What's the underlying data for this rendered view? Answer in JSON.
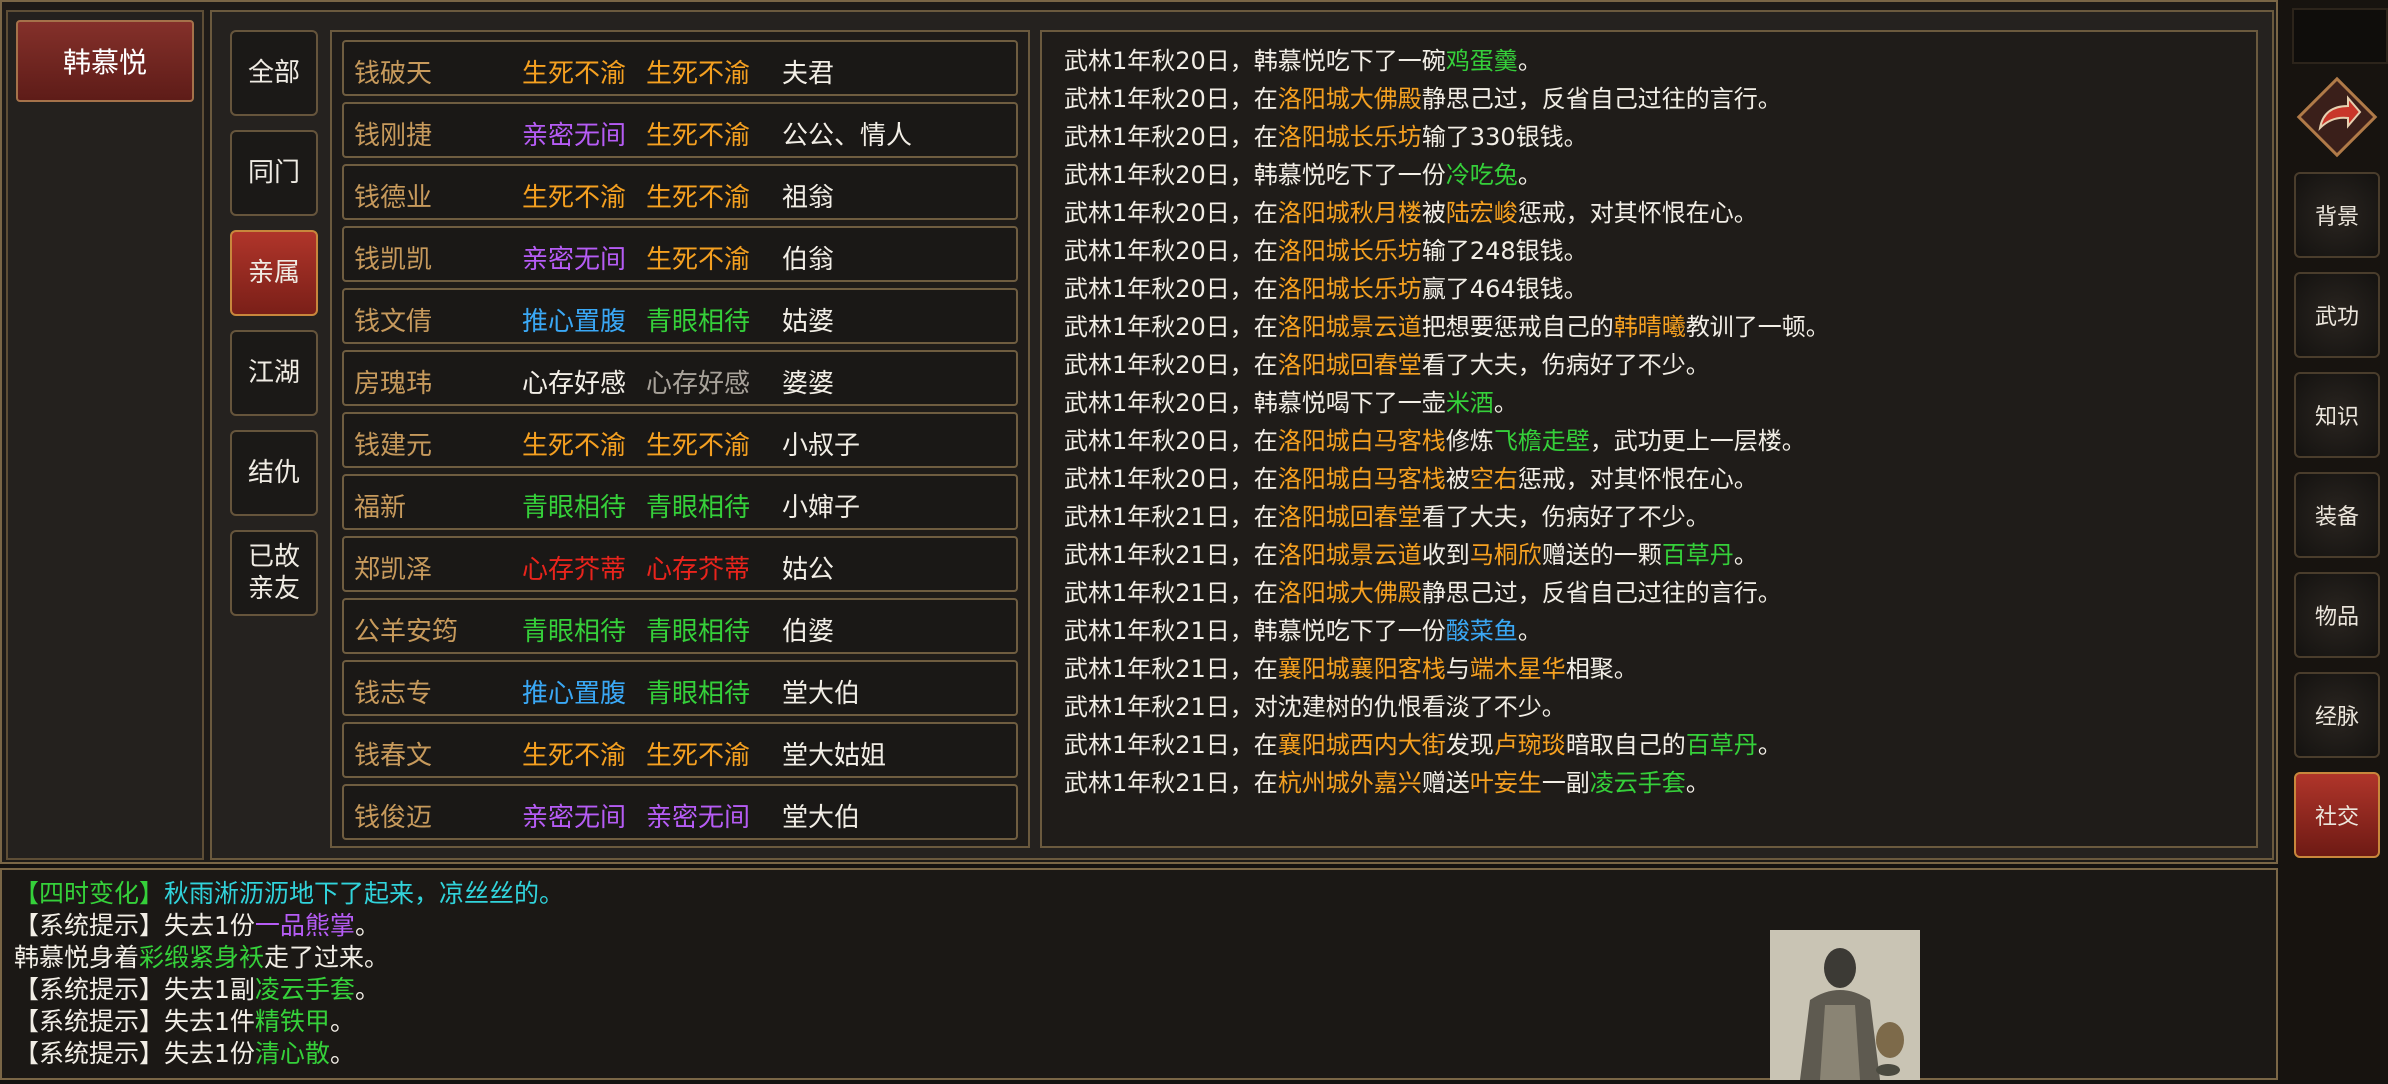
{
  "character": {
    "name": "韩慕悦"
  },
  "colors": {
    "orange": "#f5a020",
    "purple": "#b65cf5",
    "blue": "#3aa8f5",
    "green": "#35d03a",
    "red": "#e8241c",
    "white": "#f2eee6",
    "gray": "#a8a29a",
    "brown": "#c79a5c",
    "cyan": "#31d4dc"
  },
  "tabs": [
    {
      "label": "全部"
    },
    {
      "label": "同门"
    },
    {
      "label": "亲属",
      "active": true
    },
    {
      "label": "江湖"
    },
    {
      "label": "结仇"
    },
    {
      "label": "已故\n亲友"
    }
  ],
  "relations": [
    {
      "name": "钱破天",
      "rel1": "生死不渝",
      "c1": "orange",
      "rel2": "生死不渝",
      "c2": "orange",
      "relation": "夫君"
    },
    {
      "name": "钱刚捷",
      "rel1": "亲密无间",
      "c1": "purple",
      "rel2": "生死不渝",
      "c2": "orange",
      "relation": "公公、情人"
    },
    {
      "name": "钱德业",
      "rel1": "生死不渝",
      "c1": "orange",
      "rel2": "生死不渝",
      "c2": "orange",
      "relation": "祖翁"
    },
    {
      "name": "钱凯凯",
      "rel1": "亲密无间",
      "c1": "purple",
      "rel2": "生死不渝",
      "c2": "orange",
      "relation": "伯翁"
    },
    {
      "name": "钱文倩",
      "rel1": "推心置腹",
      "c1": "blue",
      "rel2": "青眼相待",
      "c2": "green",
      "relation": "姑婆"
    },
    {
      "name": "房瑰玮",
      "rel1": "心存好感",
      "c1": "white",
      "rel2": "心存好感",
      "c2": "gray",
      "relation": "婆婆"
    },
    {
      "name": "钱建元",
      "rel1": "生死不渝",
      "c1": "orange",
      "rel2": "生死不渝",
      "c2": "orange",
      "relation": "小叔子"
    },
    {
      "name": "福新",
      "rel1": "青眼相待",
      "c1": "green",
      "rel2": "青眼相待",
      "c2": "green",
      "relation": "小婶子"
    },
    {
      "name": "郑凯泽",
      "rel1": "心存芥蒂",
      "c1": "red",
      "rel2": "心存芥蒂",
      "c2": "red",
      "relation": "姑公"
    },
    {
      "name": "公羊安筠",
      "rel1": "青眼相待",
      "c1": "green",
      "rel2": "青眼相待",
      "c2": "green",
      "relation": "伯婆"
    },
    {
      "name": "钱志专",
      "rel1": "推心置腹",
      "c1": "blue",
      "rel2": "青眼相待",
      "c2": "green",
      "relation": "堂大伯"
    },
    {
      "name": "钱春文",
      "rel1": "生死不渝",
      "c1": "orange",
      "rel2": "生死不渝",
      "c2": "orange",
      "relation": "堂大姑姐"
    },
    {
      "name": "钱俊迈",
      "rel1": "亲密无间",
      "c1": "purple",
      "rel2": "亲密无间",
      "c2": "purple",
      "relation": "堂大伯"
    }
  ],
  "log": [
    [
      [
        "武林1年秋20日，韩慕悦吃下了一碗",
        "white"
      ],
      [
        "鸡蛋羹",
        "green"
      ],
      [
        "。",
        "white"
      ]
    ],
    [
      [
        "武林1年秋20日，在",
        "white"
      ],
      [
        "洛阳城大佛殿",
        "orange"
      ],
      [
        "静思己过，反省自己过往的言行。",
        "white"
      ]
    ],
    [
      [
        "武林1年秋20日，在",
        "white"
      ],
      [
        "洛阳城长乐坊",
        "orange"
      ],
      [
        "输了330银钱。",
        "white"
      ]
    ],
    [
      [
        "武林1年秋20日，韩慕悦吃下了一份",
        "white"
      ],
      [
        "冷吃兔",
        "green"
      ],
      [
        "。",
        "white"
      ]
    ],
    [
      [
        "武林1年秋20日，在",
        "white"
      ],
      [
        "洛阳城秋月楼",
        "orange"
      ],
      [
        "被",
        "white"
      ],
      [
        "陆宏峻",
        "orange"
      ],
      [
        "惩戒，对其怀恨在心。",
        "white"
      ]
    ],
    [
      [
        "武林1年秋20日，在",
        "white"
      ],
      [
        "洛阳城长乐坊",
        "orange"
      ],
      [
        "输了248银钱。",
        "white"
      ]
    ],
    [
      [
        "武林1年秋20日，在",
        "white"
      ],
      [
        "洛阳城长乐坊",
        "orange"
      ],
      [
        "赢了464银钱。",
        "white"
      ]
    ],
    [
      [
        "武林1年秋20日，在",
        "white"
      ],
      [
        "洛阳城景云道",
        "orange"
      ],
      [
        "把想要惩戒自己的",
        "white"
      ],
      [
        "韩晴曦",
        "orange"
      ],
      [
        "教训了一顿。",
        "white"
      ]
    ],
    [
      [
        "武林1年秋20日，在",
        "white"
      ],
      [
        "洛阳城回春堂",
        "orange"
      ],
      [
        "看了大夫，伤病好了不少。",
        "white"
      ]
    ],
    [
      [
        "武林1年秋20日，韩慕悦喝下了一壶",
        "white"
      ],
      [
        "米酒",
        "green"
      ],
      [
        "。",
        "white"
      ]
    ],
    [
      [
        "武林1年秋20日，在",
        "white"
      ],
      [
        "洛阳城白马客栈",
        "orange"
      ],
      [
        "修炼",
        "white"
      ],
      [
        "飞檐走壁",
        "green"
      ],
      [
        "，武功更上一层楼。",
        "white"
      ]
    ],
    [
      [
        "武林1年秋20日，在",
        "white"
      ],
      [
        "洛阳城白马客栈",
        "orange"
      ],
      [
        "被",
        "white"
      ],
      [
        "空右",
        "orange"
      ],
      [
        "惩戒，对其怀恨在心。",
        "white"
      ]
    ],
    [
      [
        "武林1年秋21日，在",
        "white"
      ],
      [
        "洛阳城回春堂",
        "orange"
      ],
      [
        "看了大夫，伤病好了不少。",
        "white"
      ]
    ],
    [
      [
        "武林1年秋21日，在",
        "white"
      ],
      [
        "洛阳城景云道",
        "orange"
      ],
      [
        "收到",
        "white"
      ],
      [
        "马桐欣",
        "orange"
      ],
      [
        "赠送的一颗",
        "white"
      ],
      [
        "百草丹",
        "green"
      ],
      [
        "。",
        "white"
      ]
    ],
    [
      [
        "武林1年秋21日，在",
        "white"
      ],
      [
        "洛阳城大佛殿",
        "orange"
      ],
      [
        "静思己过，反省自己过往的言行。",
        "white"
      ]
    ],
    [
      [
        "武林1年秋21日，韩慕悦吃下了一份",
        "white"
      ],
      [
        "酸菜鱼",
        "blue"
      ],
      [
        "。",
        "white"
      ]
    ],
    [
      [
        "武林1年秋21日，在",
        "white"
      ],
      [
        "襄阳城襄阳客栈",
        "orange"
      ],
      [
        "与",
        "white"
      ],
      [
        "端木星华",
        "orange"
      ],
      [
        "相聚。",
        "white"
      ]
    ],
    [
      [
        "武林1年秋21日，对沈建树的仇恨看淡了不少。",
        "white"
      ]
    ],
    [
      [
        "武林1年秋21日，在",
        "white"
      ],
      [
        "襄阳城西内大街",
        "orange"
      ],
      [
        "发现",
        "white"
      ],
      [
        "卢琬琰",
        "orange"
      ],
      [
        "暗取自己的",
        "white"
      ],
      [
        "百草丹",
        "green"
      ],
      [
        "。",
        "white"
      ]
    ],
    [
      [
        "武林1年秋21日，在",
        "white"
      ],
      [
        "杭州城外嘉兴",
        "orange"
      ],
      [
        "赠送",
        "white"
      ],
      [
        "叶妄生",
        "orange"
      ],
      [
        "一副",
        "white"
      ],
      [
        "凌云手套",
        "green"
      ],
      [
        "。",
        "white"
      ]
    ]
  ],
  "messages": [
    [
      [
        "【四时变化】",
        "green"
      ],
      [
        "秋雨淅沥沥地下了起来，凉丝丝的。",
        "cyan"
      ]
    ],
    [
      [
        "【系统提示】失去1份",
        "white"
      ],
      [
        "一品熊掌",
        "purple"
      ],
      [
        "。",
        "white"
      ]
    ],
    [
      [
        "韩慕悦身着",
        "white"
      ],
      [
        "彩缎紧身袄",
        "green"
      ],
      [
        "走了过来。",
        "white"
      ]
    ],
    [
      [
        "【系统提示】失去1副",
        "white"
      ],
      [
        "凌云手套",
        "green"
      ],
      [
        "。",
        "white"
      ]
    ],
    [
      [
        "【系统提示】失去1件",
        "white"
      ],
      [
        "精铁甲",
        "green"
      ],
      [
        "。",
        "white"
      ]
    ],
    [
      [
        "【系统提示】失去1份",
        "white"
      ],
      [
        "清心散",
        "green"
      ],
      [
        "。",
        "white"
      ]
    ]
  ],
  "side_menu": [
    {
      "label": "背景"
    },
    {
      "label": "武功"
    },
    {
      "label": "知识"
    },
    {
      "label": "装备"
    },
    {
      "label": "物品"
    },
    {
      "label": "经脉"
    },
    {
      "label": "社交",
      "active": true
    }
  ],
  "icons": {
    "return": "return-arrow-icon",
    "portrait": "npc-portrait"
  }
}
